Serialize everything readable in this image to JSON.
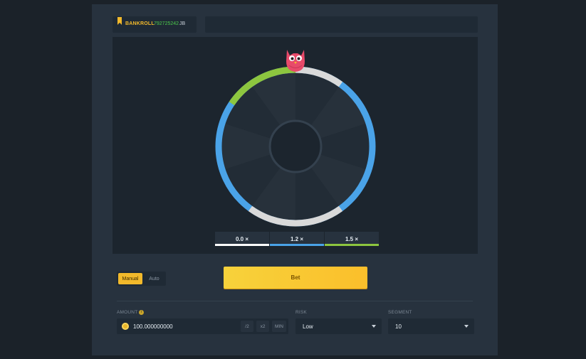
{
  "header": {
    "bankroll_label": "BANKROLL",
    "bankroll_value": "792725242",
    "bankroll_unit": "JB"
  },
  "wheel": {
    "segments": 10,
    "mascot_icon": "owl-icon",
    "colors": {
      "blue": "#4aa3e8",
      "green": "#8dc63f",
      "white": "#d9d9d9",
      "spoke_dark": "#222c36",
      "spoke_light": "#27313b"
    }
  },
  "multipliers": [
    {
      "label": "0.0 ×",
      "color": "#ffffff"
    },
    {
      "label": "1.2 ×",
      "color": "#4aa3e8"
    },
    {
      "label": "1.5 ×",
      "color": "#8dc63f"
    }
  ],
  "controls": {
    "manual_label": "Manual",
    "auto_label": "Auto",
    "bet_label": "Bet",
    "amount_label": "AMOUNT",
    "amount_value": "100.000000000",
    "half_label": "/2",
    "double_label": "x2",
    "min_label": "MIN",
    "risk_label": "RISK",
    "risk_value": "Low",
    "segment_label": "SEGMENT",
    "segment_value": "10"
  },
  "accent_color": "#f2b92b"
}
